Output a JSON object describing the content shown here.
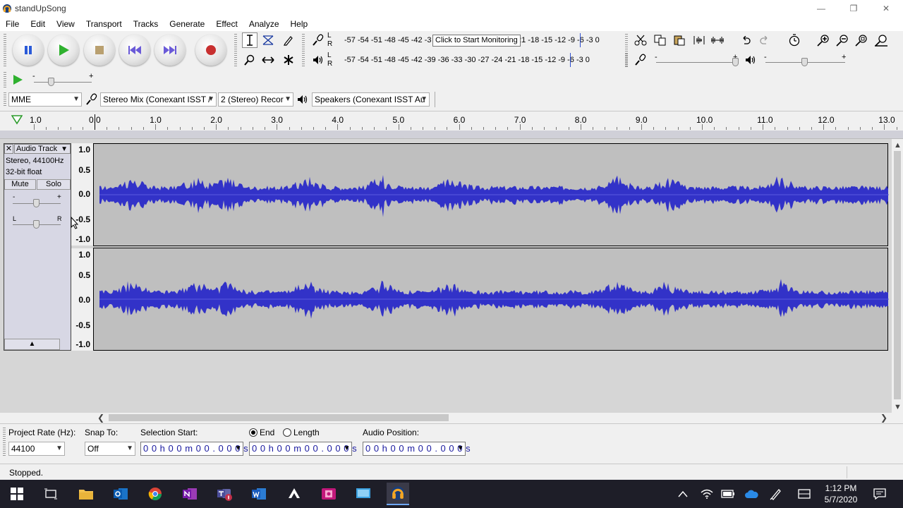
{
  "window": {
    "title": "standUpSong"
  },
  "menu": [
    "File",
    "Edit",
    "View",
    "Transport",
    "Tracks",
    "Generate",
    "Effect",
    "Analyze",
    "Help"
  ],
  "meters": {
    "lr_top": "L",
    "lr_bottom": "R",
    "record_scale": "-57 -54 -51 -48 -45 -42 -3",
    "record_scale_tail": "21 -18 -15 -12  -9  -6  -3  0",
    "playback_scale": "-57 -54 -51 -48 -45 -42 -39 -36 -33 -30 -27 -24 -21 -18 -15 -12  -9  -6  -3  0",
    "monitor_tooltip": "Click to Start Monitoring"
  },
  "mixer": {
    "minus": "-",
    "plus": "+"
  },
  "device": {
    "host": "MME",
    "recording_device": "Stereo Mix (Conexant ISST /",
    "channels": "2 (Stereo) Recor",
    "playback_device": "Speakers (Conexant ISST Au"
  },
  "timeline": {
    "ticks": [
      "1.0",
      "0.0",
      "1.0",
      "2.0",
      "3.0",
      "4.0",
      "5.0",
      "6.0",
      "7.0",
      "8.0",
      "9.0",
      "10.0",
      "11.0",
      "12.0",
      "13.0"
    ]
  },
  "track": {
    "name": "Audio Track",
    "format": "Stereo, 44100Hz",
    "bitdepth": "32-bit float",
    "mute_label": "Mute",
    "solo_label": "Solo",
    "gain_minus": "-",
    "gain_plus": "+",
    "pan_left": "L",
    "pan_right": "R",
    "vscale": [
      "1.0",
      "0.5",
      "0.0",
      "-0.5",
      "-1.0"
    ]
  },
  "selection": {
    "project_rate_label": "Project Rate (Hz):",
    "project_rate_value": "44100",
    "snap_label": "Snap To:",
    "snap_value": "Off",
    "start_label": "Selection Start:",
    "end_label": "End",
    "length_label": "Length",
    "audio_pos_label": "Audio Position:",
    "start_time": "0 0 h 0 0 m 0 0 . 0 0 0 s",
    "end_time": "0 0 h 0 0 m 0 0 . 0 0 0 s",
    "audio_position": "0 0 h 0 0 m 0 0 . 0 0 0 s"
  },
  "status": {
    "text": "Stopped."
  },
  "clock": {
    "time": "1:12 PM",
    "date": "5/7/2020"
  },
  "colors": {
    "waveform": "#3232c8",
    "track_bg": "#d7d7e4",
    "wave_bg": "#bfbfbf",
    "taskbar": "#1e1e28"
  }
}
